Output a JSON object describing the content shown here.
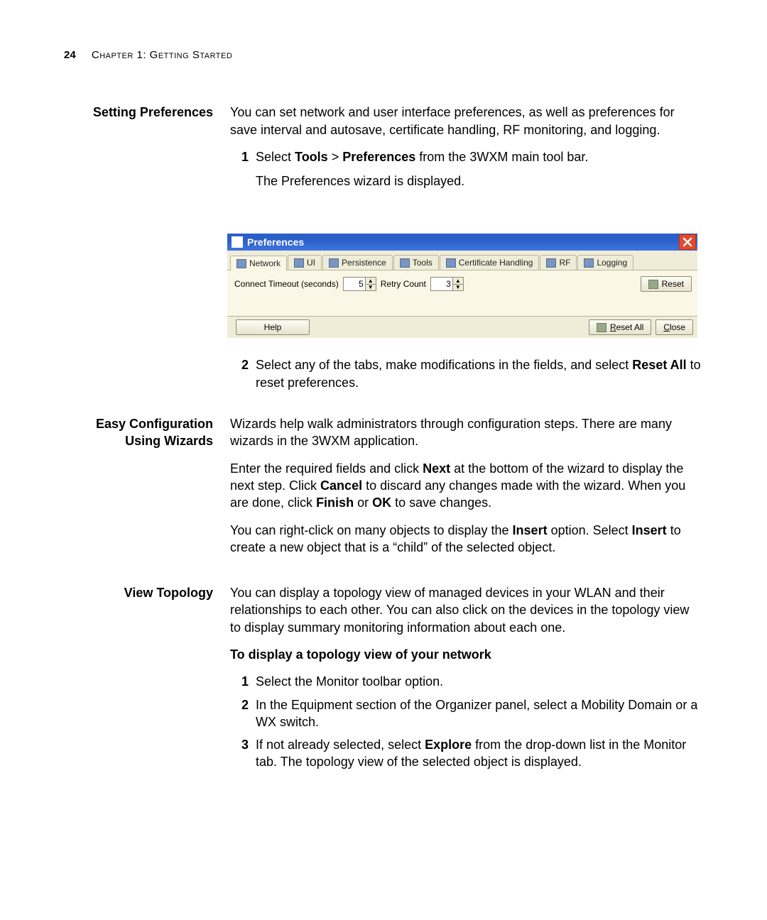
{
  "page": {
    "number": "24",
    "chapter": "Chapter 1: Getting Started"
  },
  "settingPrefs": {
    "heading": "Setting Preferences",
    "intro": "You can set network and user interface preferences, as well as preferences for save interval and autosave, certificate handling, RF monitoring, and logging.",
    "step1_a": "Select ",
    "step1_tools": "Tools",
    "step1_gt": " > ",
    "step1_prefs": "Preferences",
    "step1_b": " from the 3WXM main tool bar.",
    "step1_sub": "The Preferences wizard is displayed.",
    "step2_a": "Select any of the tabs, make modifications in the fields, and select ",
    "step2_reset": "Reset All",
    "step2_b": " to reset preferences."
  },
  "window": {
    "title": "Preferences",
    "tabs": [
      "Network",
      "UI",
      "Persistence",
      "Tools",
      "Certificate Handling",
      "RF",
      "Logging"
    ],
    "connect_label": "Connect Timeout (seconds)",
    "connect_value": "5",
    "retry_label": "Retry Count",
    "retry_value": "3",
    "reset": "Reset",
    "help": "Help",
    "reset_all_pre": "R",
    "reset_all_rest": "eset All",
    "close_pre": "C",
    "close_rest": "lose"
  },
  "wizards": {
    "heading1": "Easy Configuration",
    "heading2": "Using Wizards",
    "p1": "Wizards help walk administrators through configuration steps. There are many wizards in the 3WXM application.",
    "p2_a": "Enter the required fields and click ",
    "p2_next": "Next",
    "p2_b": " at the bottom of the wizard to display the next step. Click ",
    "p2_cancel": "Cancel",
    "p2_c": " to discard any changes made with the wizard. When you are done, click ",
    "p2_finish": "Finish",
    "p2_d": " or ",
    "p2_ok": "OK",
    "p2_e": " to save changes.",
    "p3_a": "You can right-click on many objects to display the ",
    "p3_insert1": "Insert",
    "p3_b": " option. Select ",
    "p3_insert2": "Insert",
    "p3_c": " to create a new object that is a “child” of the selected object."
  },
  "topology": {
    "heading": "View Topology",
    "intro": "You can display a topology view of managed devices in your WLAN and their relationships to each other. You can also click on the devices in the topology view to display summary monitoring information about each one.",
    "subhead": "To display a topology view of your network",
    "s1": "Select the Monitor toolbar option.",
    "s2": "In the Equipment section of the Organizer panel, select a Mobility Domain or a WX switch.",
    "s3_a": "If not already selected, select ",
    "s3_explore": "Explore",
    "s3_b": " from the drop-down list in the Monitor tab. The topology view of the selected object is displayed."
  }
}
